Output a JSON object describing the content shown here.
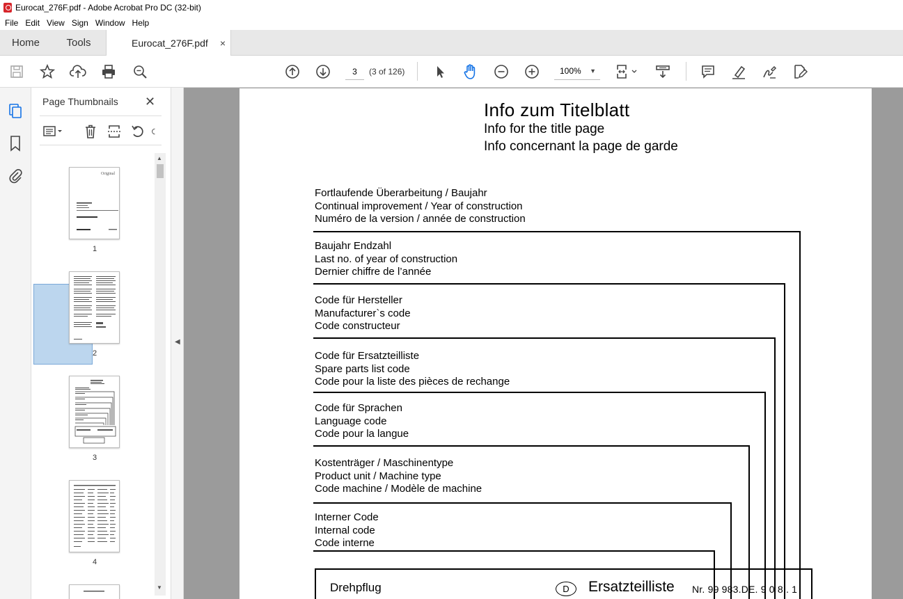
{
  "window": {
    "title": "Eurocat_276F.pdf - Adobe Acrobat Pro DC (32-bit)"
  },
  "menu": [
    "File",
    "Edit",
    "View",
    "Sign",
    "Window",
    "Help"
  ],
  "tabs": {
    "home": "Home",
    "tools": "Tools",
    "document": "Eurocat_276F.pdf",
    "close": "×"
  },
  "toolbar": {
    "current_page": "3",
    "page_of": "(3 of 126)",
    "zoom": "100%",
    "icons": [
      "save-icon",
      "bookmark-star-icon",
      "upload-icon",
      "print-icon",
      "find-icon",
      "page-up-icon",
      "page-down-icon",
      "select-arrow-icon",
      "hand-icon",
      "zoom-out-icon",
      "zoom-in-icon",
      "page-display-icon",
      "scroll-mode-icon",
      "comment-icon",
      "highlight-icon",
      "sign-icon",
      "edit-pdf-icon"
    ]
  },
  "panel": {
    "title": "Page Thumbnails",
    "close": "✕",
    "thumbnails": [
      {
        "label": "1"
      },
      {
        "label": "2"
      },
      {
        "label": "3",
        "selected": true
      },
      {
        "label": "4"
      }
    ]
  },
  "document": {
    "title": "Info  zum  Titelblatt",
    "subtitle_en": "Info for the title page",
    "subtitle_fr": "Info concernant la page de garde",
    "groups": [
      {
        "de": "Fortlaufende Überarbeitung / Baujahr",
        "en": "Continual improvement / Year of construction",
        "fr": "Numéro de la version / année de construction"
      },
      {
        "de": "Baujahr Endzahl",
        "en": "Last no. of year of construction",
        "fr": "Dernier chiffre de l’année"
      },
      {
        "de": "Code für Hersteller",
        "en": "Manufacturer`s  code",
        "fr": "Code constructeur"
      },
      {
        "de": "Code für Ersatzteilliste",
        "en": "Spare parts list code",
        "fr": "Code pour la liste des pièces de rechange"
      },
      {
        "de": "Code für Sprachen",
        "en": "Language code",
        "fr": "Code pour la langue"
      },
      {
        "de": "Kostenträger / Maschinentype",
        "en": "Product unit / Machine type",
        "fr": "Code machine / Modèle de machine"
      },
      {
        "de": "Interner Code",
        "en": "Internal code",
        "fr": "Code interne"
      }
    ],
    "bottom": {
      "machine": "Drehpflug",
      "lang_badge": "D",
      "list_title": "Ersatzteilliste",
      "number": "Nr. 99 983.DE. 9 0 8 . 1"
    }
  },
  "colors": {
    "accent": "#1473e6",
    "doc_bg": "#9b9b9b",
    "thumb_selected": "#bcd6ee"
  }
}
